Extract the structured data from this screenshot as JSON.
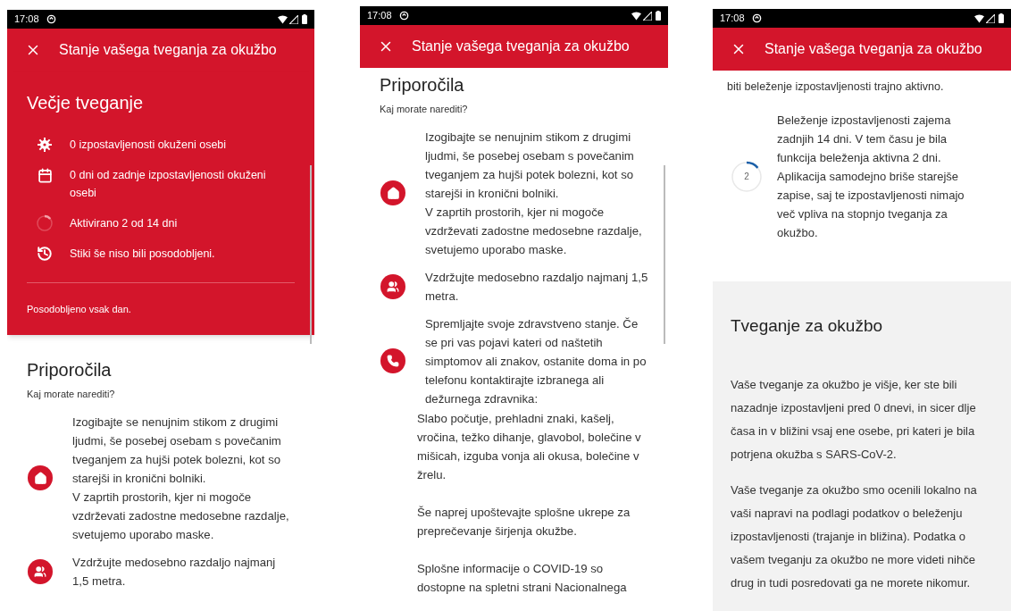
{
  "screens": [
    {
      "status_time": "17:08",
      "title": "Stanje vašega tveganja za okužbo",
      "scrollbar": true,
      "sections": [
        {
          "kind": "risk_summary",
          "heading": "Večje tveganje",
          "items": [
            {
              "kind": "virus",
              "text": "0 izpostavljenosti okuženi osebi"
            },
            {
              "kind": "calendar",
              "text": "0 dni od zadnje izpostavljenosti okuženi osebi"
            },
            {
              "kind": "progress",
              "text": "Aktivirano 2 od 14 dni",
              "level": 0.14
            },
            {
              "kind": "clock",
              "text": "Stiki še niso bili posodobljeni."
            }
          ],
          "footer": "Posodobljeno vsak dan."
        },
        {
          "kind": "recommendations",
          "heading": "Priporočila",
          "subheading": "Kaj morate narediti?",
          "items": [
            {
              "kind": "home",
              "paragraphs": [
                "Izogibajte se nenujnim stikom z drugimi ljudmi, še posebej osebam s povečanim tveganjem za hujši potek bolezni, kot so starejši in kronični bolniki.",
                "V zaprtih prostorih, kjer ni mogoče vzdrževati zadostne medosebne razdalje, svetujemo uporabo maske."
              ]
            },
            {
              "kind": "people",
              "paragraphs": [
                "Vzdržujte medosebno razdaljo najmanj 1,5 metra."
              ]
            }
          ]
        }
      ]
    },
    {
      "status_time": "17:08",
      "title": "Stanje vašega tveganja za okužbo",
      "scrollbar": true,
      "sections": [
        {
          "kind": "recommendations",
          "heading": "Priporočila",
          "subheading": "Kaj morate narediti?",
          "items": [
            {
              "kind": "home",
              "paragraphs": [
                "Izogibajte se nenujnim stikom z drugimi ljudmi, še posebej osebam s povečanim tveganjem za hujši potek bolezni, kot so starejši in kronični bolniki.",
                "V zaprtih prostorih, kjer ni mogoče vzdrževati zadostne medosebne razdalje, svetujemo uporabo maske."
              ]
            },
            {
              "kind": "people",
              "paragraphs": [
                "Vzdržujte medosebno razdaljo najmanj 1,5 metra."
              ]
            },
            {
              "kind": "phone",
              "paragraphs": [
                "Spremljajte svoje zdravstveno stanje. Če se pri vas pojavi kateri od naštetih simptomov ali znakov, ostanite doma in po telefonu kontaktirajte izbranega ali dežurnega zdravnika:"
              ]
            }
          ],
          "notes": [
            "Slabo počutje, prehladni znaki, kašelj, vročina, težko dihanje, glavobol, bolečine v mišicah, izguba vonja ali okusa, bolečine v žrelu.",
            "Še naprej upoštevajte splošne ukrepe za preprečevanje širjenja okužbe.",
            "Splošne informacije o COVID-19 so dostopne na spletni strani Nacionalnega"
          ]
        }
      ]
    },
    {
      "status_time": "17:08",
      "title": "Stanje vašega tveganja za okužbo",
      "scrollbar": false,
      "sections": [
        {
          "kind": "text",
          "paragraphs": [
            "biti beleženje izpostavljenosti trajno aktivno."
          ]
        },
        {
          "kind": "progress_note",
          "level": 0.14,
          "count": "2",
          "text": "Beleženje izpostavljenosti zajema zadnjih 14 dni. V tem času je bila funkcija beleženja aktivna  2 dni. Aplikacija samodejno briše starejše zapise, saj te izpostavljenosti nimajo več vpliva na stopnjo tveganja za okužbo."
        },
        {
          "kind": "info_card",
          "heading": "Tveganje za okužbo",
          "paragraphs": [
            "Vaše tveganje za okužbo je višje, ker ste bili nazadnje izpostavljeni pred 0 dnevi, in sicer dlje časa in v bližini vsaj ene osebe, pri kateri je bila potrjena okužba s SARS-CoV-2.",
            "Vaše tveganje za okužbo smo ocenili lokalno na vaši napravi na podlagi podatkov o beleženju izpostavljenosti (trajanje in bližina). Podatka o vašem tveganju za okužbo ne more videti nihče drug in tudi posredovati ga ne morete nikomur."
          ]
        }
      ]
    }
  ]
}
